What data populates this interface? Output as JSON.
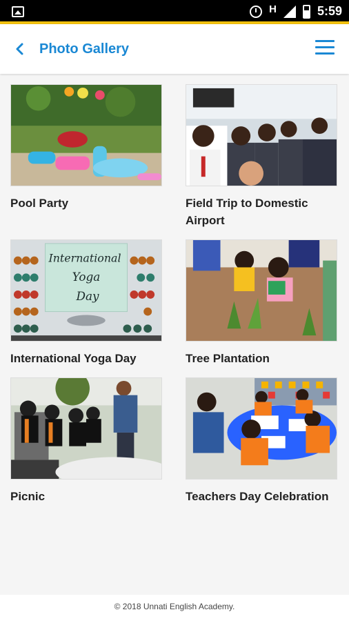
{
  "status_bar": {
    "network_indicator": "H",
    "time": "5:59"
  },
  "app_bar": {
    "title": "Photo Gallery",
    "back_icon": "chevron-left-icon",
    "menu_icon": "hamburger-menu-icon",
    "accent_color": "#1a88d4"
  },
  "gallery": {
    "items": [
      {
        "caption": "Pool Party"
      },
      {
        "caption": "Field Trip to Domestic Airport"
      },
      {
        "caption": "International Yoga Day",
        "sign_text_line1": "International",
        "sign_text_line2": "Yoga",
        "sign_text_line3": "Day"
      },
      {
        "caption": "Tree Plantation"
      },
      {
        "caption": "Picnic"
      },
      {
        "caption": "Teachers Day Celebration"
      }
    ]
  },
  "footer": {
    "copyright": "© 2018 Unnati English Academy."
  }
}
